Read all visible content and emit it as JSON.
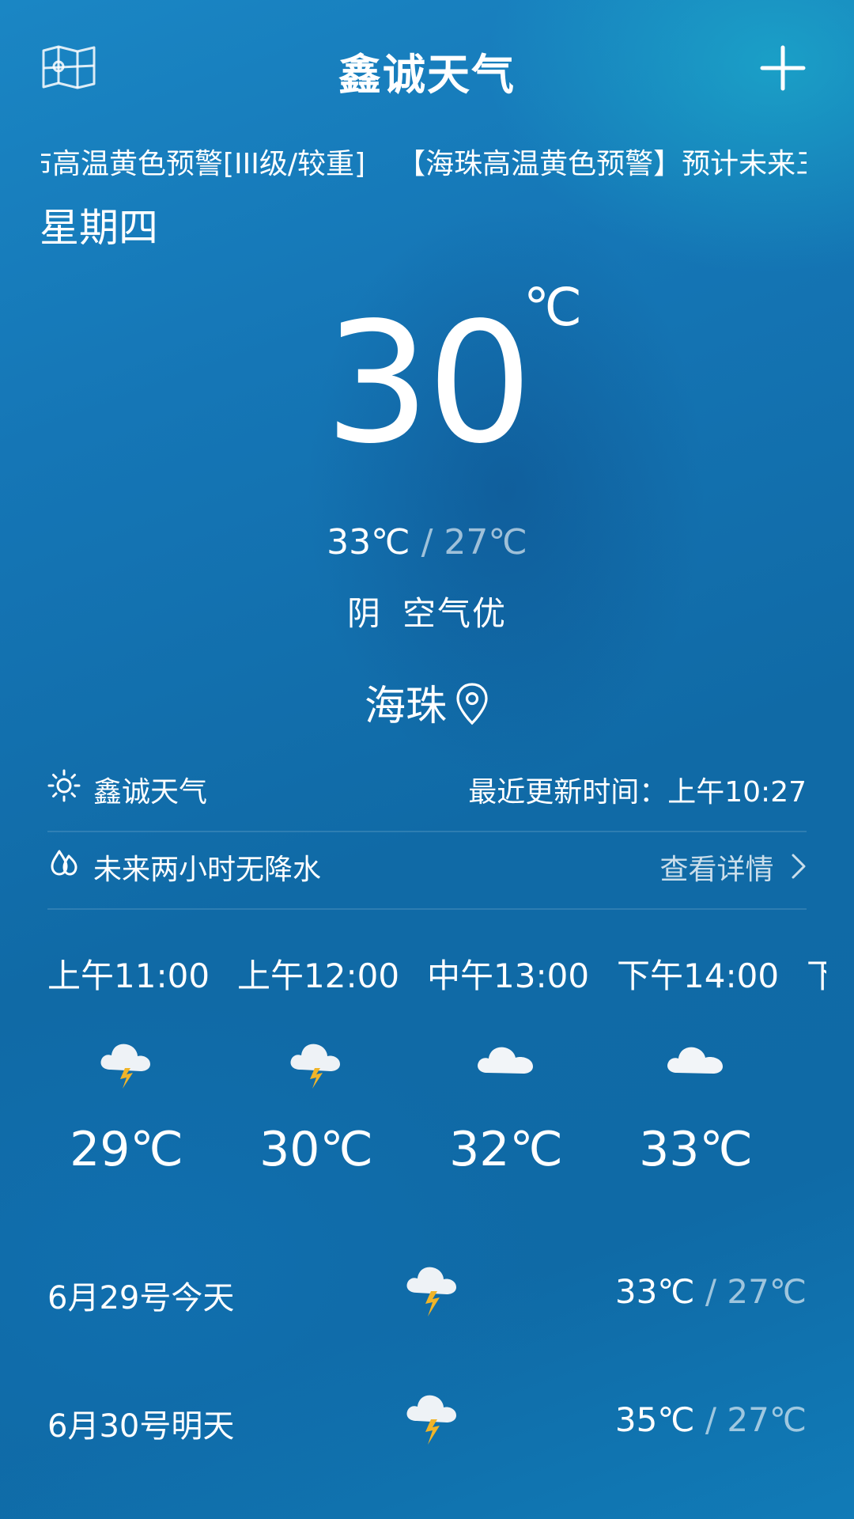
{
  "header": {
    "title": "鑫诚天气",
    "map_icon": "map-icon",
    "add_icon": "plus-icon"
  },
  "alert": {
    "text1": "布高温黄色预警[III级/较重]",
    "text2": "【海珠高温黄色预警】预计未来三"
  },
  "current": {
    "weekday": "星期四",
    "temperature": "30",
    "unit": "℃",
    "high": "33℃",
    "separator": "/",
    "low": "27℃",
    "condition": "阴",
    "air_quality": "空气优",
    "location": "海珠"
  },
  "info": {
    "source_label": "鑫诚天气",
    "update_time": "最近更新时间：上午10:27",
    "rain_text": "未来两小时无降水",
    "details_label": "查看详情"
  },
  "hourly": [
    {
      "time": "上午11:00",
      "icon": "thunderstorm-icon",
      "temp": "29℃"
    },
    {
      "time": "上午12:00",
      "icon": "thunderstorm-icon",
      "temp": "30℃"
    },
    {
      "time": "中午13:00",
      "icon": "cloudy-icon",
      "temp": "32℃"
    },
    {
      "time": "下午14:00",
      "icon": "cloudy-icon",
      "temp": "33℃"
    },
    {
      "time": "下",
      "icon": "",
      "temp": ""
    }
  ],
  "daily": [
    {
      "date": "6月29号今天",
      "icon": "thunderstorm-icon",
      "high": "33℃",
      "low": "27℃"
    },
    {
      "date": "6月30号明天",
      "icon": "thunderstorm-icon",
      "high": "35℃",
      "low": "27℃"
    }
  ],
  "colors": {
    "background_top": "#1a86c4",
    "background_bottom": "#0f6aa6",
    "text": "#ffffff",
    "muted": "#a9d2ea"
  }
}
